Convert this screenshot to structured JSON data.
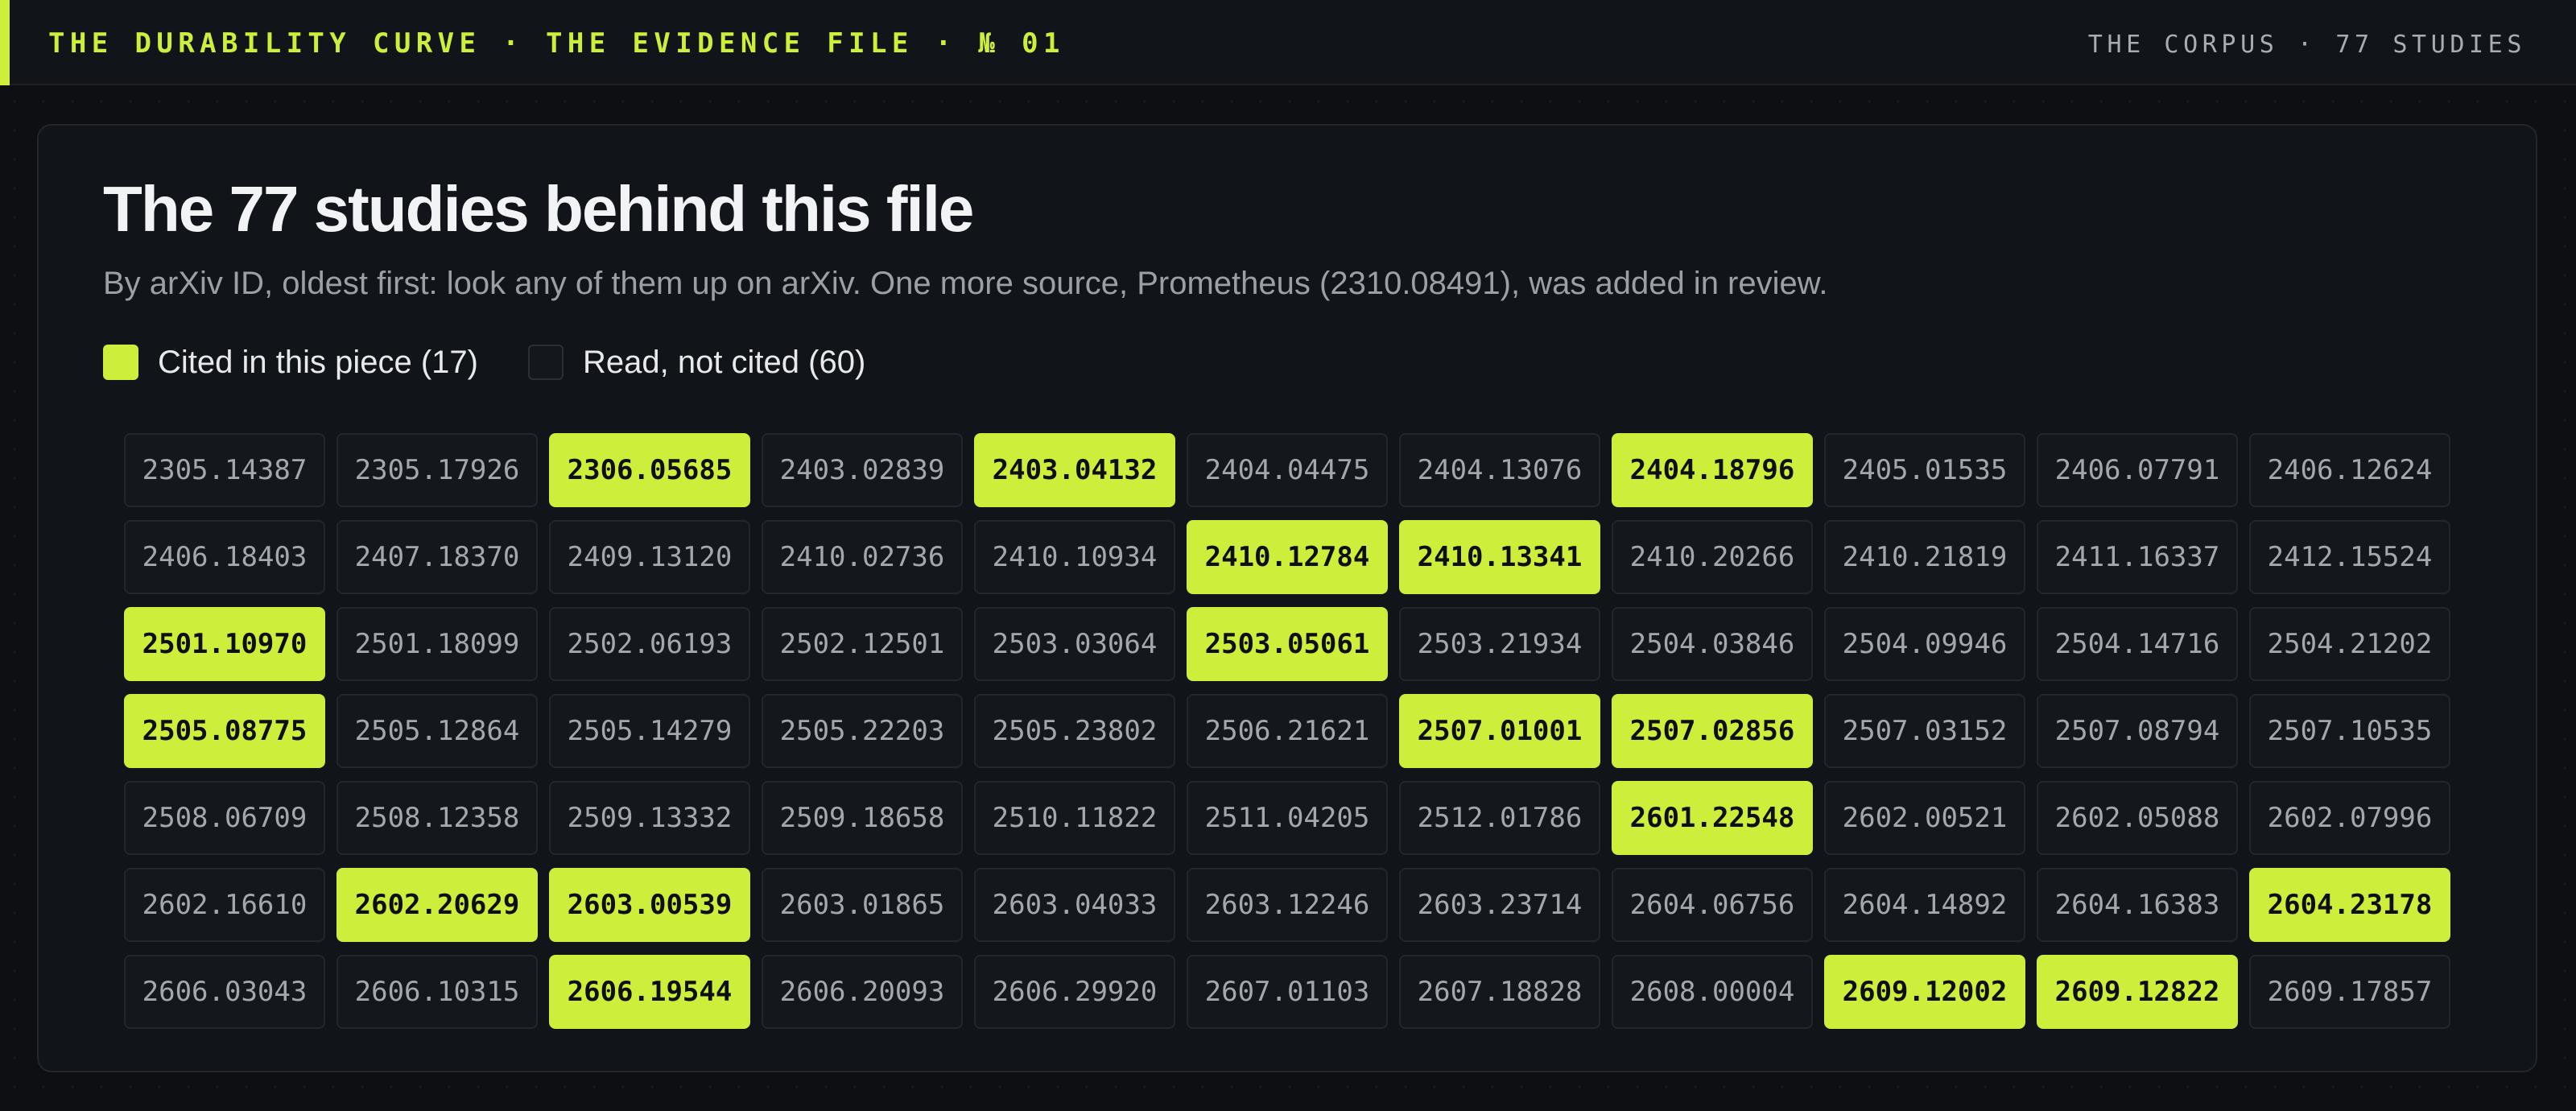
{
  "header": {
    "kicker": "THE DURABILITY CURVE · THE EVIDENCE FILE · № 01",
    "corpus_label": "THE CORPUS · 77 STUDIES"
  },
  "panel": {
    "title": "The 77 studies behind this file",
    "subtitle": "By arXiv ID, oldest first: look any of them up on arXiv. One more source, Prometheus (2310.08491), was added in review.",
    "legend": {
      "cited_label": "Cited in this piece (17)",
      "uncited_label": "Read, not cited (60)"
    }
  },
  "colors": {
    "accent": "#cdee3a",
    "background": "#0d0f12",
    "panel": "#111418",
    "cell": "#14171b"
  },
  "studies": [
    {
      "id": "2305.14387",
      "cited": false
    },
    {
      "id": "2305.17926",
      "cited": false
    },
    {
      "id": "2306.05685",
      "cited": true
    },
    {
      "id": "2403.02839",
      "cited": false
    },
    {
      "id": "2403.04132",
      "cited": true
    },
    {
      "id": "2404.04475",
      "cited": false
    },
    {
      "id": "2404.13076",
      "cited": false
    },
    {
      "id": "2404.18796",
      "cited": true
    },
    {
      "id": "2405.01535",
      "cited": false
    },
    {
      "id": "2406.07791",
      "cited": false
    },
    {
      "id": "2406.12624",
      "cited": false
    },
    {
      "id": "2406.18403",
      "cited": false
    },
    {
      "id": "2407.18370",
      "cited": false
    },
    {
      "id": "2409.13120",
      "cited": false
    },
    {
      "id": "2410.02736",
      "cited": false
    },
    {
      "id": "2410.10934",
      "cited": false
    },
    {
      "id": "2410.12784",
      "cited": true
    },
    {
      "id": "2410.13341",
      "cited": true
    },
    {
      "id": "2410.20266",
      "cited": false
    },
    {
      "id": "2410.21819",
      "cited": false
    },
    {
      "id": "2411.16337",
      "cited": false
    },
    {
      "id": "2412.15524",
      "cited": false
    },
    {
      "id": "2501.10970",
      "cited": true
    },
    {
      "id": "2501.18099",
      "cited": false
    },
    {
      "id": "2502.06193",
      "cited": false
    },
    {
      "id": "2502.12501",
      "cited": false
    },
    {
      "id": "2503.03064",
      "cited": false
    },
    {
      "id": "2503.05061",
      "cited": true
    },
    {
      "id": "2503.21934",
      "cited": false
    },
    {
      "id": "2504.03846",
      "cited": false
    },
    {
      "id": "2504.09946",
      "cited": false
    },
    {
      "id": "2504.14716",
      "cited": false
    },
    {
      "id": "2504.21202",
      "cited": false
    },
    {
      "id": "2505.08775",
      "cited": true
    },
    {
      "id": "2505.12864",
      "cited": false
    },
    {
      "id": "2505.14279",
      "cited": false
    },
    {
      "id": "2505.22203",
      "cited": false
    },
    {
      "id": "2505.23802",
      "cited": false
    },
    {
      "id": "2506.21621",
      "cited": false
    },
    {
      "id": "2507.01001",
      "cited": true
    },
    {
      "id": "2507.02856",
      "cited": true
    },
    {
      "id": "2507.03152",
      "cited": false
    },
    {
      "id": "2507.08794",
      "cited": false
    },
    {
      "id": "2507.10535",
      "cited": false
    },
    {
      "id": "2508.06709",
      "cited": false
    },
    {
      "id": "2508.12358",
      "cited": false
    },
    {
      "id": "2509.13332",
      "cited": false
    },
    {
      "id": "2509.18658",
      "cited": false
    },
    {
      "id": "2510.11822",
      "cited": false
    },
    {
      "id": "2511.04205",
      "cited": false
    },
    {
      "id": "2512.01786",
      "cited": false
    },
    {
      "id": "2601.22548",
      "cited": true
    },
    {
      "id": "2602.00521",
      "cited": false
    },
    {
      "id": "2602.05088",
      "cited": false
    },
    {
      "id": "2602.07996",
      "cited": false
    },
    {
      "id": "2602.16610",
      "cited": false
    },
    {
      "id": "2602.20629",
      "cited": true
    },
    {
      "id": "2603.00539",
      "cited": true
    },
    {
      "id": "2603.01865",
      "cited": false
    },
    {
      "id": "2603.04033",
      "cited": false
    },
    {
      "id": "2603.12246",
      "cited": false
    },
    {
      "id": "2603.23714",
      "cited": false
    },
    {
      "id": "2604.06756",
      "cited": false
    },
    {
      "id": "2604.14892",
      "cited": false
    },
    {
      "id": "2604.16383",
      "cited": false
    },
    {
      "id": "2604.23178",
      "cited": true
    },
    {
      "id": "2606.03043",
      "cited": false
    },
    {
      "id": "2606.10315",
      "cited": false
    },
    {
      "id": "2606.19544",
      "cited": true
    },
    {
      "id": "2606.20093",
      "cited": false
    },
    {
      "id": "2606.29920",
      "cited": false
    },
    {
      "id": "2607.01103",
      "cited": false
    },
    {
      "id": "2607.18828",
      "cited": false
    },
    {
      "id": "2608.00004",
      "cited": false
    },
    {
      "id": "2609.12002",
      "cited": true
    },
    {
      "id": "2609.12822",
      "cited": true
    },
    {
      "id": "2609.17857",
      "cited": false
    }
  ]
}
